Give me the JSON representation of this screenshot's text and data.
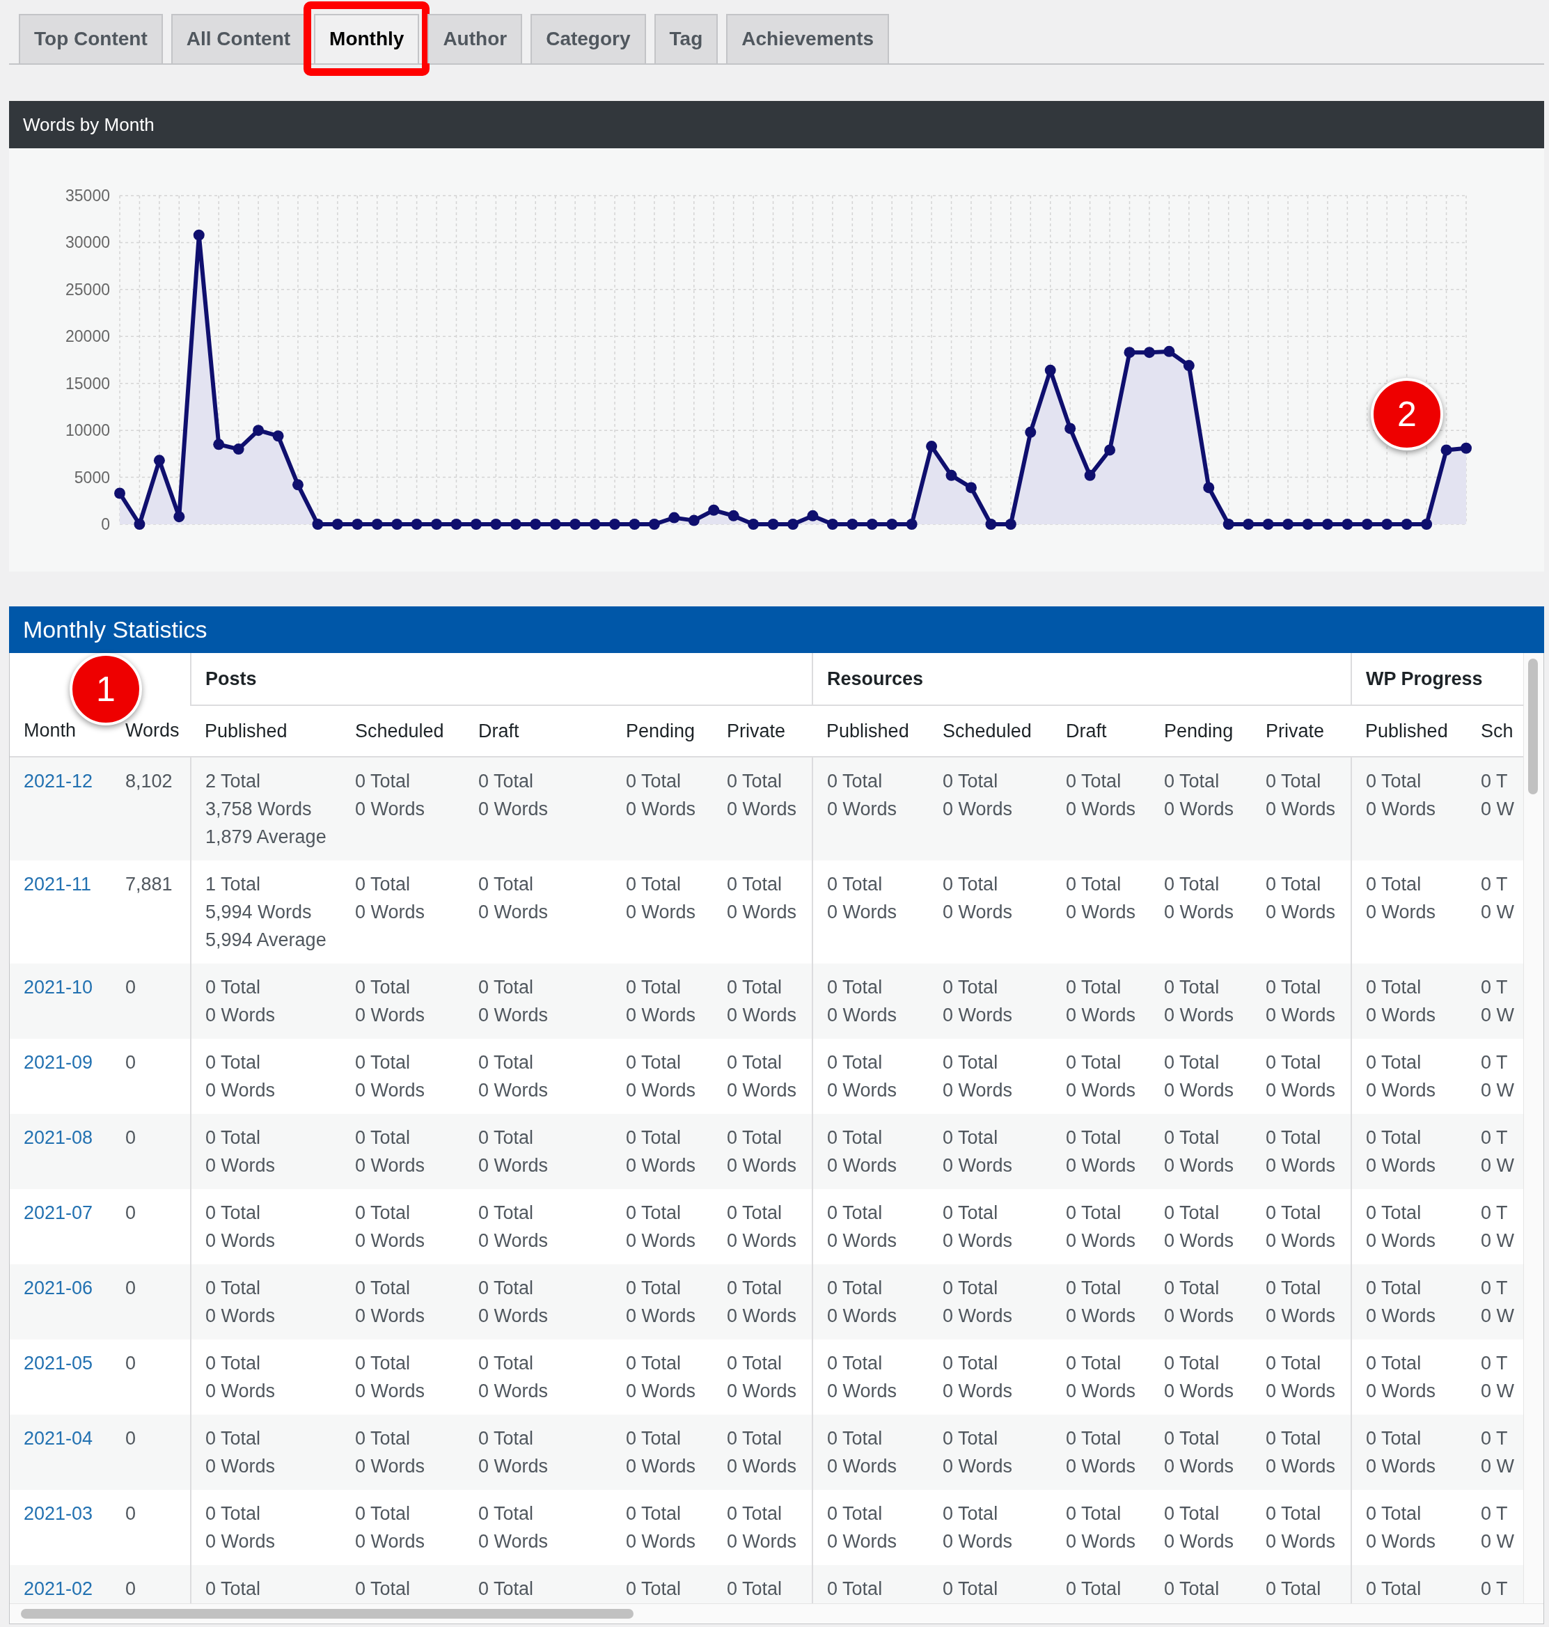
{
  "tabs": [
    {
      "label": "Top Content",
      "selected": false,
      "highlighted": false
    },
    {
      "label": "All Content",
      "selected": false,
      "highlighted": false
    },
    {
      "label": "Monthly",
      "selected": true,
      "highlighted": true
    },
    {
      "label": "Author",
      "selected": false,
      "highlighted": false
    },
    {
      "label": "Category",
      "selected": false,
      "highlighted": false
    },
    {
      "label": "Tag",
      "selected": false,
      "highlighted": false
    },
    {
      "label": "Achievements",
      "selected": false,
      "highlighted": false
    }
  ],
  "chart": {
    "callout": "2",
    "chart_data": {
      "type": "area",
      "title": "Words by Month",
      "grid": true,
      "ylim": [
        0,
        35000
      ],
      "yticks": [
        0,
        5000,
        10000,
        15000,
        20000,
        25000,
        30000,
        35000
      ],
      "series": [
        {
          "color": "#0f0f6e",
          "values": [
            3300,
            0,
            6800,
            800,
            30800,
            8500,
            8000,
            10000,
            9400,
            4200,
            0,
            0,
            0,
            0,
            0,
            0,
            0,
            0,
            0,
            0,
            0,
            0,
            0,
            0,
            0,
            0,
            0,
            0,
            700,
            400,
            1500,
            900,
            0,
            0,
            0,
            900,
            0,
            0,
            0,
            0,
            0,
            8300,
            5200,
            3900,
            0,
            0,
            9800,
            16400,
            10200,
            5200,
            7900,
            18300,
            18300,
            18400,
            16900,
            3900,
            0,
            0,
            0,
            0,
            0,
            0,
            0,
            0,
            0,
            0,
            0,
            7900,
            8100
          ]
        }
      ]
    }
  },
  "table": {
    "title": "Monthly Statistics",
    "callout": "1",
    "groups": [
      "Posts",
      "Resources",
      "WP Progress"
    ],
    "columns": [
      "Month",
      "Words",
      "Published",
      "Scheduled",
      "Draft",
      "Pending",
      "Private",
      "Published",
      "Scheduled",
      "Draft",
      "Pending",
      "Private",
      "Published",
      "Sch"
    ],
    "rows": [
      {
        "cells": [
          "2021-12",
          "8,102",
          [
            "2 Total",
            "3,758 Words",
            "1,879 Average"
          ],
          [
            "0 Total",
            "0 Words"
          ],
          [
            "0 Total",
            "0 Words"
          ],
          [
            "0 Total",
            "0 Words"
          ],
          [
            "0 Total",
            "0 Words"
          ],
          [
            "0 Total",
            "0 Words"
          ],
          [
            "0 Total",
            "0 Words"
          ],
          [
            "0 Total",
            "0 Words"
          ],
          [
            "0 Total",
            "0 Words"
          ],
          [
            "0 Total",
            "0 Words"
          ],
          [
            "0 Total",
            "0 Words"
          ],
          [
            "0 T",
            "0 W"
          ]
        ]
      },
      {
        "cells": [
          "2021-11",
          "7,881",
          [
            "1 Total",
            "5,994 Words",
            "5,994 Average"
          ],
          [
            "0 Total",
            "0 Words"
          ],
          [
            "0 Total",
            "0 Words"
          ],
          [
            "0 Total",
            "0 Words"
          ],
          [
            "0 Total",
            "0 Words"
          ],
          [
            "0 Total",
            "0 Words"
          ],
          [
            "0 Total",
            "0 Words"
          ],
          [
            "0 Total",
            "0 Words"
          ],
          [
            "0 Total",
            "0 Words"
          ],
          [
            "0 Total",
            "0 Words"
          ],
          [
            "0 Total",
            "0 Words"
          ],
          [
            "0 T",
            "0 W"
          ]
        ]
      },
      {
        "cells": [
          "2021-10",
          "0",
          [
            "0 Total",
            "0 Words"
          ],
          [
            "0 Total",
            "0 Words"
          ],
          [
            "0 Total",
            "0 Words"
          ],
          [
            "0 Total",
            "0 Words"
          ],
          [
            "0 Total",
            "0 Words"
          ],
          [
            "0 Total",
            "0 Words"
          ],
          [
            "0 Total",
            "0 Words"
          ],
          [
            "0 Total",
            "0 Words"
          ],
          [
            "0 Total",
            "0 Words"
          ],
          [
            "0 Total",
            "0 Words"
          ],
          [
            "0 Total",
            "0 Words"
          ],
          [
            "0 T",
            "0 W"
          ]
        ]
      },
      {
        "cells": [
          "2021-09",
          "0",
          [
            "0 Total",
            "0 Words"
          ],
          [
            "0 Total",
            "0 Words"
          ],
          [
            "0 Total",
            "0 Words"
          ],
          [
            "0 Total",
            "0 Words"
          ],
          [
            "0 Total",
            "0 Words"
          ],
          [
            "0 Total",
            "0 Words"
          ],
          [
            "0 Total",
            "0 Words"
          ],
          [
            "0 Total",
            "0 Words"
          ],
          [
            "0 Total",
            "0 Words"
          ],
          [
            "0 Total",
            "0 Words"
          ],
          [
            "0 Total",
            "0 Words"
          ],
          [
            "0 T",
            "0 W"
          ]
        ]
      },
      {
        "cells": [
          "2021-08",
          "0",
          [
            "0 Total",
            "0 Words"
          ],
          [
            "0 Total",
            "0 Words"
          ],
          [
            "0 Total",
            "0 Words"
          ],
          [
            "0 Total",
            "0 Words"
          ],
          [
            "0 Total",
            "0 Words"
          ],
          [
            "0 Total",
            "0 Words"
          ],
          [
            "0 Total",
            "0 Words"
          ],
          [
            "0 Total",
            "0 Words"
          ],
          [
            "0 Total",
            "0 Words"
          ],
          [
            "0 Total",
            "0 Words"
          ],
          [
            "0 Total",
            "0 Words"
          ],
          [
            "0 T",
            "0 W"
          ]
        ]
      },
      {
        "cells": [
          "2021-07",
          "0",
          [
            "0 Total",
            "0 Words"
          ],
          [
            "0 Total",
            "0 Words"
          ],
          [
            "0 Total",
            "0 Words"
          ],
          [
            "0 Total",
            "0 Words"
          ],
          [
            "0 Total",
            "0 Words"
          ],
          [
            "0 Total",
            "0 Words"
          ],
          [
            "0 Total",
            "0 Words"
          ],
          [
            "0 Total",
            "0 Words"
          ],
          [
            "0 Total",
            "0 Words"
          ],
          [
            "0 Total",
            "0 Words"
          ],
          [
            "0 Total",
            "0 Words"
          ],
          [
            "0 T",
            "0 W"
          ]
        ]
      },
      {
        "cells": [
          "2021-06",
          "0",
          [
            "0 Total",
            "0 Words"
          ],
          [
            "0 Total",
            "0 Words"
          ],
          [
            "0 Total",
            "0 Words"
          ],
          [
            "0 Total",
            "0 Words"
          ],
          [
            "0 Total",
            "0 Words"
          ],
          [
            "0 Total",
            "0 Words"
          ],
          [
            "0 Total",
            "0 Words"
          ],
          [
            "0 Total",
            "0 Words"
          ],
          [
            "0 Total",
            "0 Words"
          ],
          [
            "0 Total",
            "0 Words"
          ],
          [
            "0 Total",
            "0 Words"
          ],
          [
            "0 T",
            "0 W"
          ]
        ]
      },
      {
        "cells": [
          "2021-05",
          "0",
          [
            "0 Total",
            "0 Words"
          ],
          [
            "0 Total",
            "0 Words"
          ],
          [
            "0 Total",
            "0 Words"
          ],
          [
            "0 Total",
            "0 Words"
          ],
          [
            "0 Total",
            "0 Words"
          ],
          [
            "0 Total",
            "0 Words"
          ],
          [
            "0 Total",
            "0 Words"
          ],
          [
            "0 Total",
            "0 Words"
          ],
          [
            "0 Total",
            "0 Words"
          ],
          [
            "0 Total",
            "0 Words"
          ],
          [
            "0 Total",
            "0 Words"
          ],
          [
            "0 T",
            "0 W"
          ]
        ]
      },
      {
        "cells": [
          "2021-04",
          "0",
          [
            "0 Total",
            "0 Words"
          ],
          [
            "0 Total",
            "0 Words"
          ],
          [
            "0 Total",
            "0 Words"
          ],
          [
            "0 Total",
            "0 Words"
          ],
          [
            "0 Total",
            "0 Words"
          ],
          [
            "0 Total",
            "0 Words"
          ],
          [
            "0 Total",
            "0 Words"
          ],
          [
            "0 Total",
            "0 Words"
          ],
          [
            "0 Total",
            "0 Words"
          ],
          [
            "0 Total",
            "0 Words"
          ],
          [
            "0 Total",
            "0 Words"
          ],
          [
            "0 T",
            "0 W"
          ]
        ]
      },
      {
        "cells": [
          "2021-03",
          "0",
          [
            "0 Total",
            "0 Words"
          ],
          [
            "0 Total",
            "0 Words"
          ],
          [
            "0 Total",
            "0 Words"
          ],
          [
            "0 Total",
            "0 Words"
          ],
          [
            "0 Total",
            "0 Words"
          ],
          [
            "0 Total",
            "0 Words"
          ],
          [
            "0 Total",
            "0 Words"
          ],
          [
            "0 Total",
            "0 Words"
          ],
          [
            "0 Total",
            "0 Words"
          ],
          [
            "0 Total",
            "0 Words"
          ],
          [
            "0 Total",
            "0 Words"
          ],
          [
            "0 T",
            "0 W"
          ]
        ]
      },
      {
        "cells": [
          "2021-02",
          "0",
          [
            "0 Total"
          ],
          [
            "0 Total"
          ],
          [
            "0 Total"
          ],
          [
            "0 Total"
          ],
          [
            "0 Total"
          ],
          [
            "0 Total"
          ],
          [
            "0 Total"
          ],
          [
            "0 Total"
          ],
          [
            "0 Total"
          ],
          [
            "0 Total"
          ],
          [
            "0 Total"
          ],
          [
            "0 T"
          ]
        ]
      }
    ]
  }
}
